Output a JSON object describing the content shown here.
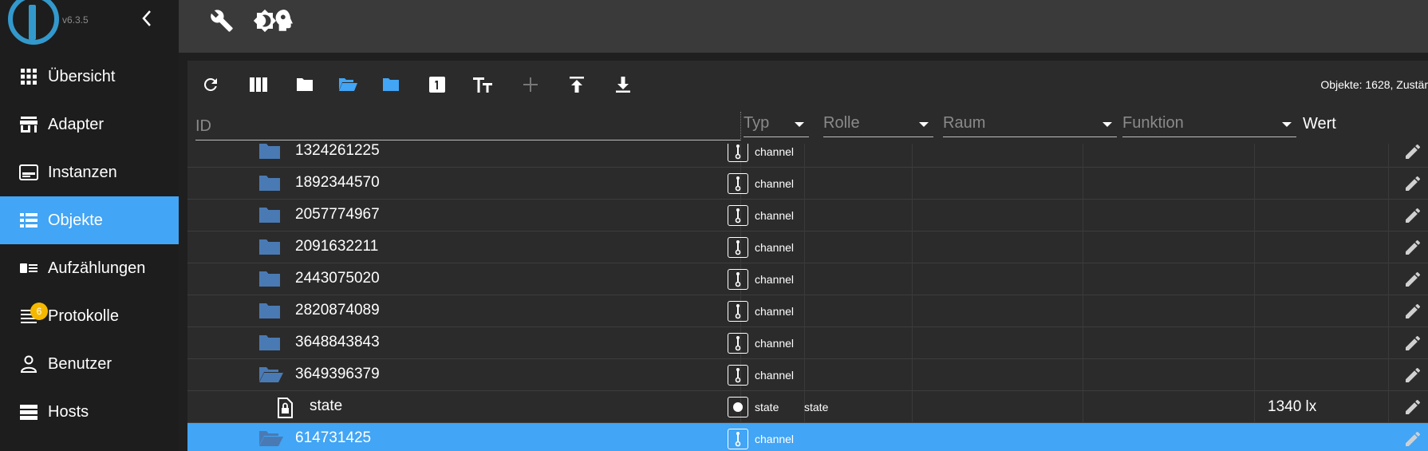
{
  "app": {
    "version": "v6.3.5",
    "accent": "#42a5f5",
    "folder_color": "#4a7ab4"
  },
  "sidebar": {
    "items": [
      {
        "label": "Übersicht",
        "icon": "apps-grid-icon",
        "active": false
      },
      {
        "label": "Adapter",
        "icon": "store-icon",
        "active": false
      },
      {
        "label": "Instanzen",
        "icon": "instances-icon",
        "active": false
      },
      {
        "label": "Objekte",
        "icon": "list-icon",
        "active": true
      },
      {
        "label": "Aufzählungen",
        "icon": "enum-card-icon",
        "active": false
      },
      {
        "label": "Protokolle",
        "icon": "log-lines-icon",
        "active": false,
        "badge": "6"
      },
      {
        "label": "Benutzer",
        "icon": "user-icon",
        "active": false
      },
      {
        "label": "Hosts",
        "icon": "hosts-icon",
        "active": false
      }
    ]
  },
  "topbar": {
    "tools": [
      "wrench-icon",
      "brightness-icon",
      "expert-head-icon"
    ]
  },
  "toolbar": {
    "buttons": [
      "refresh-icon",
      "columns-icon",
      "folder-icon",
      "folder-open-icon",
      "folder-blue-icon",
      "number-one-icon",
      "text-size-icon",
      "add-icon",
      "upload-icon",
      "download-icon"
    ],
    "stats": "Objekte: 1628, Zustär"
  },
  "filters": {
    "id_placeholder": "ID",
    "typ": "Typ",
    "rolle": "Rolle",
    "raum": "Raum",
    "funktion": "Funktion",
    "wert": "Wert"
  },
  "rows": [
    {
      "id": "1324261225",
      "type": "channel",
      "role": "",
      "value": "",
      "icon": "folder-closed-icon",
      "indent": 1,
      "selected": false
    },
    {
      "id": "1892344570",
      "type": "channel",
      "role": "",
      "value": "",
      "icon": "folder-closed-icon",
      "indent": 1,
      "selected": false
    },
    {
      "id": "2057774967",
      "type": "channel",
      "role": "",
      "value": "",
      "icon": "folder-closed-icon",
      "indent": 1,
      "selected": false
    },
    {
      "id": "2091632211",
      "type": "channel",
      "role": "",
      "value": "",
      "icon": "folder-closed-icon",
      "indent": 1,
      "selected": false
    },
    {
      "id": "2443075020",
      "type": "channel",
      "role": "",
      "value": "",
      "icon": "folder-closed-icon",
      "indent": 1,
      "selected": false
    },
    {
      "id": "2820874089",
      "type": "channel",
      "role": "",
      "value": "",
      "icon": "folder-closed-icon",
      "indent": 1,
      "selected": false
    },
    {
      "id": "3648843843",
      "type": "channel",
      "role": "",
      "value": "",
      "icon": "folder-closed-icon",
      "indent": 1,
      "selected": false
    },
    {
      "id": "3649396379",
      "type": "channel",
      "role": "",
      "value": "",
      "icon": "folder-open-icon",
      "indent": 1,
      "selected": false
    },
    {
      "id": "state",
      "type": "state",
      "role": "state",
      "value": "1340 lx",
      "icon": "state-file-icon",
      "indent": 2,
      "selected": false
    },
    {
      "id": "614731425",
      "type": "channel",
      "role": "",
      "value": "",
      "icon": "folder-open-icon",
      "indent": 1,
      "selected": true
    }
  ]
}
